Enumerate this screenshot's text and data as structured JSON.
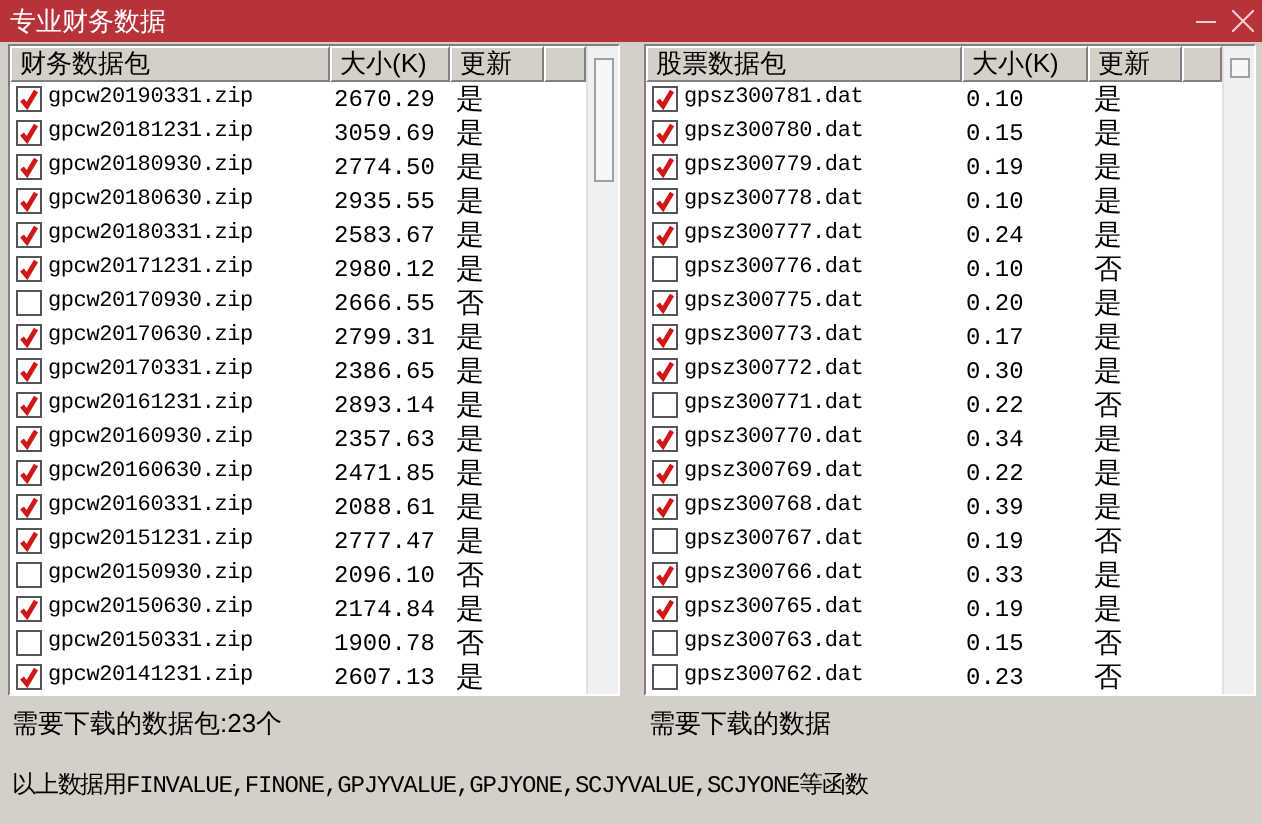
{
  "window": {
    "title": "专业财务数据"
  },
  "lists": [
    {
      "columns": [
        "财务数据包",
        "大小(K)",
        "更新"
      ],
      "summary": "需要下载的数据包:23个",
      "rows": [
        {
          "name": "gpcw20190331.zip",
          "size": "2670.29",
          "update": "是",
          "checked": true
        },
        {
          "name": "gpcw20181231.zip",
          "size": "3059.69",
          "update": "是",
          "checked": true
        },
        {
          "name": "gpcw20180930.zip",
          "size": "2774.50",
          "update": "是",
          "checked": true
        },
        {
          "name": "gpcw20180630.zip",
          "size": "2935.55",
          "update": "是",
          "checked": true
        },
        {
          "name": "gpcw20180331.zip",
          "size": "2583.67",
          "update": "是",
          "checked": true
        },
        {
          "name": "gpcw20171231.zip",
          "size": "2980.12",
          "update": "是",
          "checked": true
        },
        {
          "name": "gpcw20170930.zip",
          "size": "2666.55",
          "update": "否",
          "checked": false
        },
        {
          "name": "gpcw20170630.zip",
          "size": "2799.31",
          "update": "是",
          "checked": true
        },
        {
          "name": "gpcw20170331.zip",
          "size": "2386.65",
          "update": "是",
          "checked": true
        },
        {
          "name": "gpcw20161231.zip",
          "size": "2893.14",
          "update": "是",
          "checked": true
        },
        {
          "name": "gpcw20160930.zip",
          "size": "2357.63",
          "update": "是",
          "checked": true
        },
        {
          "name": "gpcw20160630.zip",
          "size": "2471.85",
          "update": "是",
          "checked": true
        },
        {
          "name": "gpcw20160331.zip",
          "size": "2088.61",
          "update": "是",
          "checked": true
        },
        {
          "name": "gpcw20151231.zip",
          "size": "2777.47",
          "update": "是",
          "checked": true
        },
        {
          "name": "gpcw20150930.zip",
          "size": "2096.10",
          "update": "否",
          "checked": false
        },
        {
          "name": "gpcw20150630.zip",
          "size": "2174.84",
          "update": "是",
          "checked": true
        },
        {
          "name": "gpcw20150331.zip",
          "size": "1900.78",
          "update": "否",
          "checked": false
        },
        {
          "name": "gpcw20141231.zip",
          "size": "2607.13",
          "update": "是",
          "checked": true
        }
      ]
    },
    {
      "columns": [
        "股票数据包",
        "大小(K)",
        "更新"
      ],
      "summary": "需要下载的数据",
      "rows": [
        {
          "name": "gpsz300781.dat",
          "size": "0.10",
          "update": "是",
          "checked": true
        },
        {
          "name": "gpsz300780.dat",
          "size": "0.15",
          "update": "是",
          "checked": true
        },
        {
          "name": "gpsz300779.dat",
          "size": "0.19",
          "update": "是",
          "checked": true
        },
        {
          "name": "gpsz300778.dat",
          "size": "0.10",
          "update": "是",
          "checked": true
        },
        {
          "name": "gpsz300777.dat",
          "size": "0.24",
          "update": "是",
          "checked": true
        },
        {
          "name": "gpsz300776.dat",
          "size": "0.10",
          "update": "否",
          "checked": false
        },
        {
          "name": "gpsz300775.dat",
          "size": "0.20",
          "update": "是",
          "checked": true
        },
        {
          "name": "gpsz300773.dat",
          "size": "0.17",
          "update": "是",
          "checked": true
        },
        {
          "name": "gpsz300772.dat",
          "size": "0.30",
          "update": "是",
          "checked": true
        },
        {
          "name": "gpsz300771.dat",
          "size": "0.22",
          "update": "否",
          "checked": false
        },
        {
          "name": "gpsz300770.dat",
          "size": "0.34",
          "update": "是",
          "checked": true
        },
        {
          "name": "gpsz300769.dat",
          "size": "0.22",
          "update": "是",
          "checked": true
        },
        {
          "name": "gpsz300768.dat",
          "size": "0.39",
          "update": "是",
          "checked": true
        },
        {
          "name": "gpsz300767.dat",
          "size": "0.19",
          "update": "否",
          "checked": false
        },
        {
          "name": "gpsz300766.dat",
          "size": "0.33",
          "update": "是",
          "checked": true
        },
        {
          "name": "gpsz300765.dat",
          "size": "0.19",
          "update": "是",
          "checked": true
        },
        {
          "name": "gpsz300763.dat",
          "size": "0.15",
          "update": "否",
          "checked": false
        },
        {
          "name": "gpsz300762.dat",
          "size": "0.23",
          "update": "否",
          "checked": false
        }
      ]
    }
  ],
  "footer": "以上数据用FINVALUE,FINONE,GPJYVALUE,GPJYONE,SCJYVALUE,SCJYONE等函数"
}
